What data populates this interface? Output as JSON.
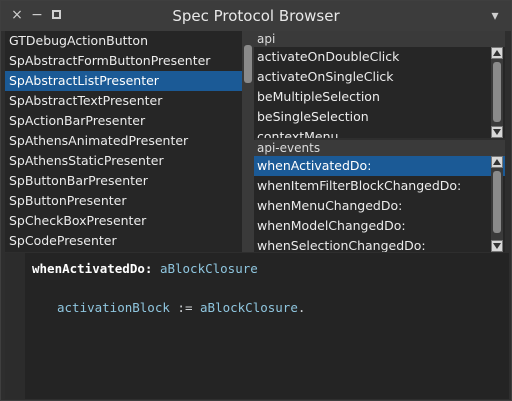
{
  "window": {
    "title": "Spec Protocol Browser",
    "close_icon": "×",
    "minimize_icon": "−",
    "menu_icon": "▾"
  },
  "class_list": {
    "items": [
      "GTDebugActionButton",
      "SpAbstractFormButtonPresenter",
      "SpAbstractListPresenter",
      "SpAbstractTextPresenter",
      "SpActionBarPresenter",
      "SpAthensAnimatedPresenter",
      "SpAthensStaticPresenter",
      "SpButtonBarPresenter",
      "SpButtonPresenter",
      "SpCheckBoxPresenter",
      "SpCodePresenter"
    ],
    "selected_index": 2
  },
  "api_pane": {
    "header": "api",
    "items": [
      "activateOnDoubleClick",
      "activateOnSingleClick",
      "beMultipleSelection",
      "beSingleSelection",
      "contextMenu"
    ]
  },
  "events_pane": {
    "header": "api-events",
    "items": [
      "whenActivatedDo:",
      "whenItemFilterBlockChangedDo:",
      "whenMenuChangedDo:",
      "whenModelChangedDo:",
      "whenSelectionChangedDo:"
    ],
    "selected_index": 0
  },
  "code": {
    "selector": "whenActivatedDo:",
    "argument": "aBlockClosure",
    "body_var": "activationBlock",
    "body_op": ":=",
    "body_value": "aBlockClosure",
    "body_end": "."
  },
  "colors": {
    "selection": "#1b5a96",
    "argument": "#8fc6df"
  }
}
